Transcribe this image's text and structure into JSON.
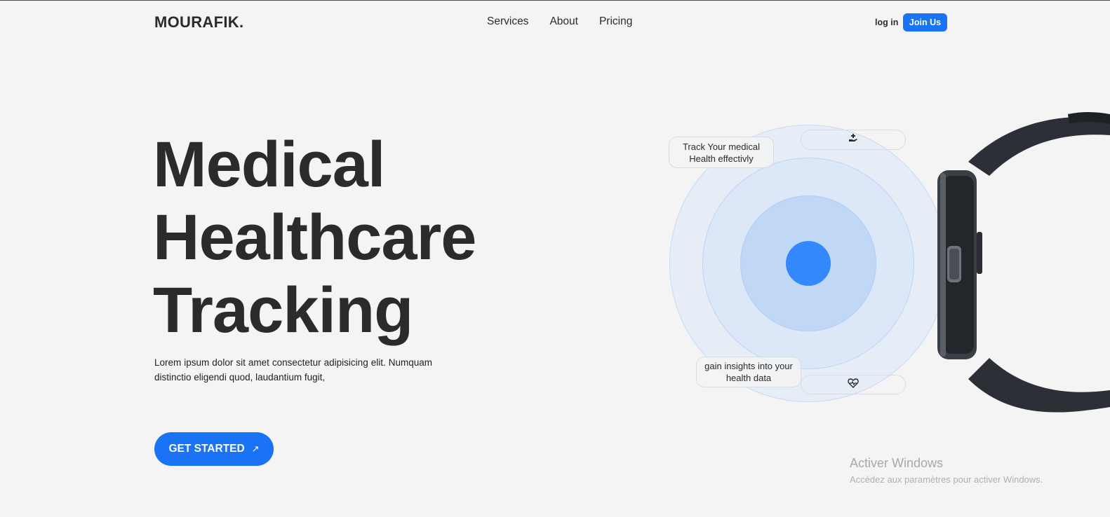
{
  "nav": {
    "logo": "MOURAFIK.",
    "links": [
      "Services",
      "About",
      "Pricing"
    ],
    "login": "log in",
    "join": "Join Us"
  },
  "hero": {
    "title_lines": [
      "Medical",
      "Healthcare",
      "Tracking"
    ],
    "description": "Lorem ipsum dolor sit amet consectetur adipisicing elit. Numquam distinctio eligendi quod, laudantium fugit,",
    "cta": "GET STARTED",
    "cta_icon": "arrow-up-right-icon"
  },
  "illustration": {
    "bubble_top": "Track Your medical Health effectivly",
    "bubble_bottom": "gain insights into your health data",
    "pill_top_icon": "hand-medical-icon",
    "pill_bottom_icon": "heart-pulse-icon",
    "accent": "#3388fb"
  },
  "watermark": {
    "title": "Activer Windows",
    "subtitle": "Accédez aux paramètres pour activer Windows."
  },
  "colors": {
    "primary": "#1a73f5",
    "background": "#f4f4f4",
    "text": "#2b2b2b"
  }
}
